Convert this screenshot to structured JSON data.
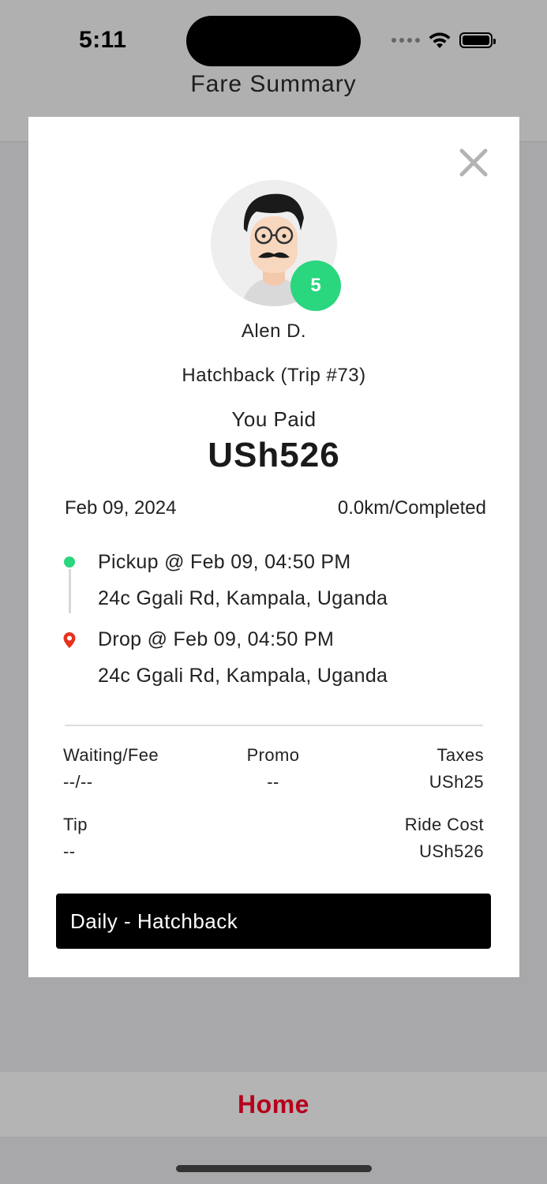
{
  "status_bar": {
    "time": "5:11"
  },
  "header": {
    "title": "Fare Summary"
  },
  "modal": {
    "driver_name": "Alen D.",
    "rating": "5",
    "vehicle_trip": "Hatchback (Trip #73)",
    "paid_label": "You Paid",
    "paid_amount": "USh526",
    "date": "Feb 09, 2024",
    "distance_status": "0.0km/Completed",
    "pickup": {
      "label": "Pickup @ Feb 09, 04:50 PM",
      "address": "24c Ggali Rd, Kampala, Uganda"
    },
    "drop": {
      "label": "Drop @ Feb 09, 04:50 PM",
      "address": "24c Ggali Rd, Kampala, Uganda"
    },
    "fees": {
      "waiting_label": "Waiting/Fee",
      "waiting_value": "--/--",
      "promo_label": "Promo",
      "promo_value": "--",
      "taxes_label": "Taxes",
      "taxes_value": "USh25",
      "tip_label": "Tip",
      "tip_value": "--",
      "ride_cost_label": "Ride Cost",
      "ride_cost_value": "USh526"
    },
    "plan_button": "Daily - Hatchback"
  },
  "bottom_nav": {
    "home_label": "Home"
  },
  "colors": {
    "accent_green": "#2ad67e",
    "home_red": "#b5001a",
    "pin_red": "#e8321e",
    "overlay": "#a8a8aa"
  },
  "icons": {
    "close": "close-icon",
    "pickup": "pickup-dot-icon",
    "drop": "drop-pin-icon",
    "wifi": "wifi-icon",
    "battery": "battery-icon"
  }
}
